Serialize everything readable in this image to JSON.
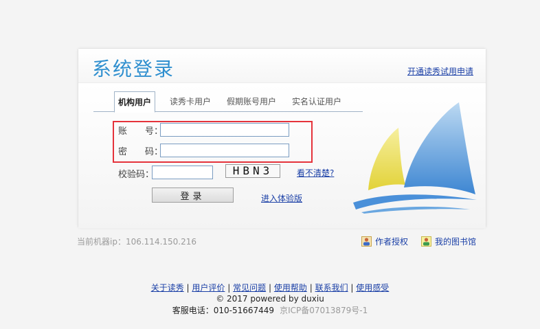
{
  "panel": {
    "title": "系统登录",
    "trial_link": "开通读秀试用申请"
  },
  "tabs": [
    {
      "label": "机构用户",
      "active": true
    },
    {
      "label": "读秀卡用户",
      "active": false
    },
    {
      "label": "假期账号用户",
      "active": false
    },
    {
      "label": "实名认证用户",
      "active": false
    }
  ],
  "form": {
    "account_label": "账　　号：",
    "account_value": "",
    "password_label": "密　　码：",
    "password_value": "",
    "captcha_label": "校验码：",
    "captcha_value": "",
    "captcha_text": "HBN3",
    "refresh_link": "看不清楚?",
    "login_button": "登录",
    "demo_link": "进入体验版"
  },
  "info": {
    "ip_text": "当前机器ip：106.114.150.216",
    "author_link": "作者授权",
    "library_link": "我的图书馆"
  },
  "footer": {
    "links": [
      "关于读秀",
      "用户评价",
      "常见问题",
      "使用帮助",
      "联系我们",
      "使用感受"
    ],
    "separator": "|",
    "copyright": "© 2017 powered by duxiu",
    "phone": "客服电话：010-51667449",
    "icp": "京ICP备07013879号-1"
  },
  "colors": {
    "title_blue": "#2f8fcf",
    "link_blue": "#1a3fa6",
    "highlight_red": "#e5323a",
    "sail_blue": "#4a90d9",
    "sail_yellow": "#e9dc52"
  }
}
